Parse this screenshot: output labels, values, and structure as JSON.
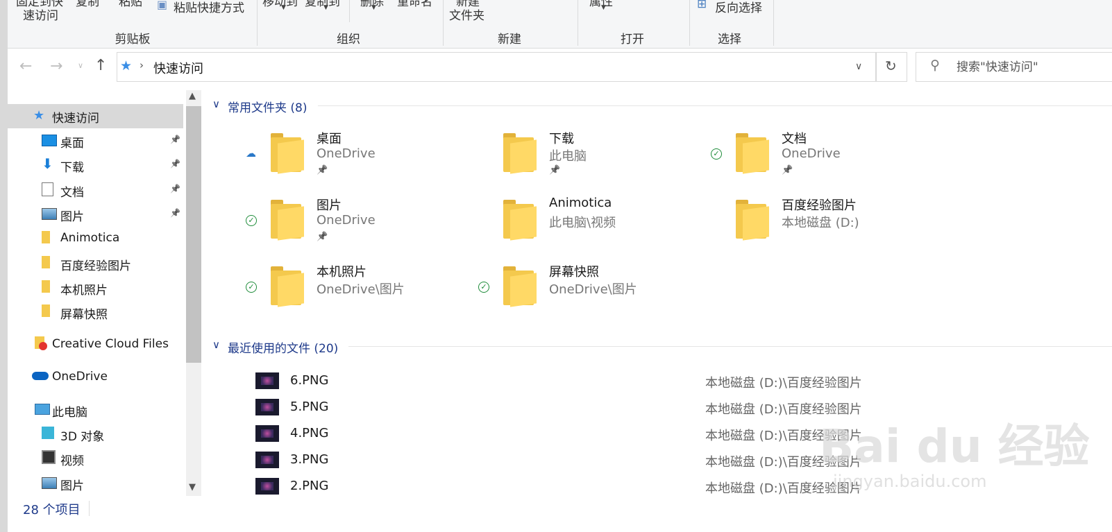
{
  "ribbon": {
    "clipboard_items": {
      "pin_label_top": "固定到快",
      "pin_label_bottom": "速访问",
      "copy_label": "复制",
      "paste_label": "粘贴",
      "paste_shortcut": "粘贴快捷方式"
    },
    "organize_items": {
      "move_to": "移动到",
      "copy_to": "复制到"
    },
    "delete_items": {
      "delete": "删除",
      "rename": "重命名"
    },
    "new_items": {
      "new_top": "新建",
      "new_bottom": "文件夹"
    },
    "open_items": {
      "properties": "属性"
    },
    "select_items": {
      "invert": "反向选择"
    },
    "groups": {
      "clipboard": "剪贴板",
      "organize": "组织",
      "new": "新建",
      "open": "打开",
      "select": "选择"
    }
  },
  "address": {
    "path": "快速访问",
    "search_placeholder": "搜索\"快速访问\""
  },
  "nav": {
    "quick_access": "快速访问",
    "items": [
      {
        "label": "桌面",
        "icon": "desktop-icon",
        "pinned": true
      },
      {
        "label": "下载",
        "icon": "download-icon",
        "pinned": true
      },
      {
        "label": "文档",
        "icon": "document-icon",
        "pinned": true
      },
      {
        "label": "图片",
        "icon": "pictures-icon",
        "pinned": true
      },
      {
        "label": "Animotica",
        "icon": "folder-icon",
        "pinned": false
      },
      {
        "label": "百度经验图片",
        "icon": "folder-icon",
        "pinned": false
      },
      {
        "label": "本机照片",
        "icon": "folder-icon",
        "pinned": false
      },
      {
        "label": "屏幕快照",
        "icon": "folder-icon",
        "pinned": false
      }
    ],
    "creative_cloud": "Creative Cloud Files",
    "onedrive": "OneDrive",
    "this_pc": "此电脑",
    "pc_items": [
      {
        "label": "3D 对象",
        "icon": "3d-objects-icon"
      },
      {
        "label": "视频",
        "icon": "video-icon"
      },
      {
        "label": "图片",
        "icon": "pictures-icon"
      }
    ]
  },
  "frequent": {
    "header": "常用文件夹 (8)",
    "folders": [
      {
        "name": "桌面",
        "location": "OneDrive",
        "status": "cloud",
        "pinned": true
      },
      {
        "name": "下载",
        "location": "此电脑",
        "status": "none",
        "pinned": true
      },
      {
        "name": "文档",
        "location": "OneDrive",
        "status": "synced",
        "pinned": true
      },
      {
        "name": "图片",
        "location": "OneDrive",
        "status": "synced",
        "pinned": true
      },
      {
        "name": "Animotica",
        "location": "此电脑\\视频",
        "status": "none",
        "pinned": false
      },
      {
        "name": "百度经验图片",
        "location": "本地磁盘 (D:)",
        "status": "none",
        "pinned": false
      },
      {
        "name": "本机照片",
        "location": "OneDrive\\图片",
        "status": "synced",
        "pinned": false
      },
      {
        "name": "屏幕快照",
        "location": "OneDrive\\图片",
        "status": "synced",
        "pinned": false
      }
    ]
  },
  "recent": {
    "header": "最近使用的文件 (20)",
    "files": [
      {
        "name": "6.PNG",
        "path": "本地磁盘 (D:)\\百度经验图片"
      },
      {
        "name": "5.PNG",
        "path": "本地磁盘 (D:)\\百度经验图片"
      },
      {
        "name": "4.PNG",
        "path": "本地磁盘 (D:)\\百度经验图片"
      },
      {
        "name": "3.PNG",
        "path": "本地磁盘 (D:)\\百度经验图片"
      },
      {
        "name": "2.PNG",
        "path": "本地磁盘 (D:)\\百度经验图片"
      }
    ]
  },
  "status": {
    "count": "28 个项目"
  },
  "watermark": {
    "brand": "Bai du 经验",
    "url": "jingyan.baidu.com"
  },
  "colors": {
    "accent": "#1e3a8a",
    "synced": "#1e8c3a",
    "folder": "#ffd966"
  }
}
